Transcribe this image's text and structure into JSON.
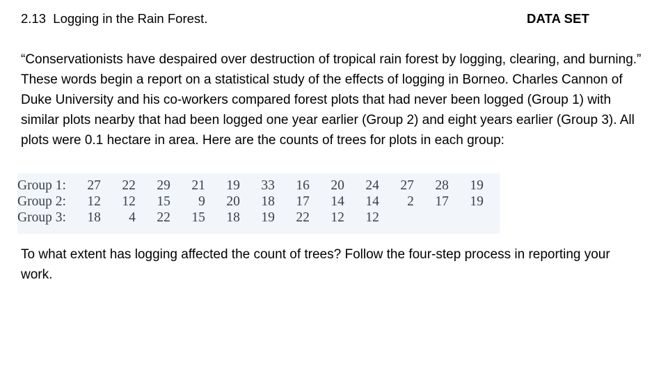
{
  "header": {
    "exercise_number": "2.13",
    "exercise_title": "Logging in the Rain Forest.",
    "title_full": "2.13  Logging in the Rain Forest.",
    "dataset_flag": "DATA SET"
  },
  "intro_paragraph": "“Conservationists have despaired over destruction of tropical rain forest by logging, clearing, and burning.” These words begin a report on a statistical study of the effects of logging in Borneo. Charles Cannon of Duke University and his co-workers compared forest plots that had never been logged (Group 1) with similar plots nearby that had been logged one year earlier (Group 2) and eight years earlier (Group 3). All plots were 0.1 hectare in area. Here are the counts of trees for plots in each group:",
  "closing_paragraph": "To what extent has logging affected the count of trees? Follow the four-step process in reporting your work.",
  "data_table": {
    "panel_background": "#f2f6fb",
    "rows": [
      {
        "label": "Group 1:",
        "values": [
          "27",
          "22",
          "29",
          "21",
          "19",
          "33",
          "16",
          "20",
          "24",
          "27",
          "28",
          "19"
        ]
      },
      {
        "label": "Group 2:",
        "values": [
          "12",
          "12",
          "15",
          "9",
          "20",
          "18",
          "17",
          "14",
          "14",
          "2",
          "17",
          "19"
        ]
      },
      {
        "label": "Group 3:",
        "values": [
          "18",
          "4",
          "22",
          "15",
          "18",
          "19",
          "22",
          "12",
          "12",
          "",
          "",
          ""
        ]
      }
    ]
  }
}
